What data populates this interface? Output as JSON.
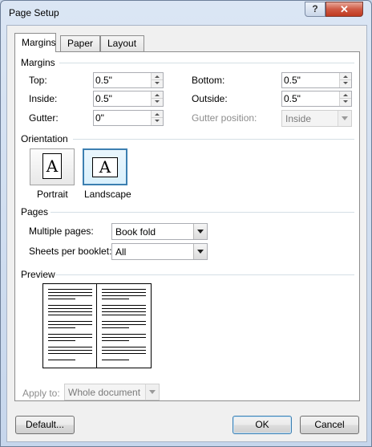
{
  "window": {
    "title": "Page Setup",
    "help": "?",
    "close": "✕"
  },
  "tabs": [
    "Margins",
    "Paper",
    "Layout"
  ],
  "margins": {
    "section": "Margins",
    "top": {
      "label": "Top:",
      "value": "0.5\""
    },
    "inside": {
      "label": "Inside:",
      "value": "0.5\""
    },
    "gutter": {
      "label": "Gutter:",
      "value": "0\""
    },
    "bottom": {
      "label": "Bottom:",
      "value": "0.5\""
    },
    "outside": {
      "label": "Outside:",
      "value": "0.5\""
    },
    "gutter_position": {
      "label": "Gutter position:",
      "value": "Inside"
    }
  },
  "orientation": {
    "section": "Orientation",
    "portrait": {
      "label": "Portrait",
      "glyph": "A"
    },
    "landscape": {
      "label": "Landscape",
      "glyph": "A",
      "selected": true
    }
  },
  "pages": {
    "section": "Pages",
    "multiple_pages": {
      "label": "Multiple pages:",
      "value": "Book fold"
    },
    "sheets_per_booklet": {
      "label": "Sheets per booklet:",
      "value": "All"
    }
  },
  "preview": {
    "section": "Preview"
  },
  "apply_to": {
    "label": "Apply to:",
    "value": "Whole document"
  },
  "buttons": {
    "default": "Default...",
    "ok": "OK",
    "cancel": "Cancel"
  },
  "colors": {
    "accent": "#3c7fb1",
    "close": "#c0391f",
    "section_line": "#d5dfe5"
  }
}
